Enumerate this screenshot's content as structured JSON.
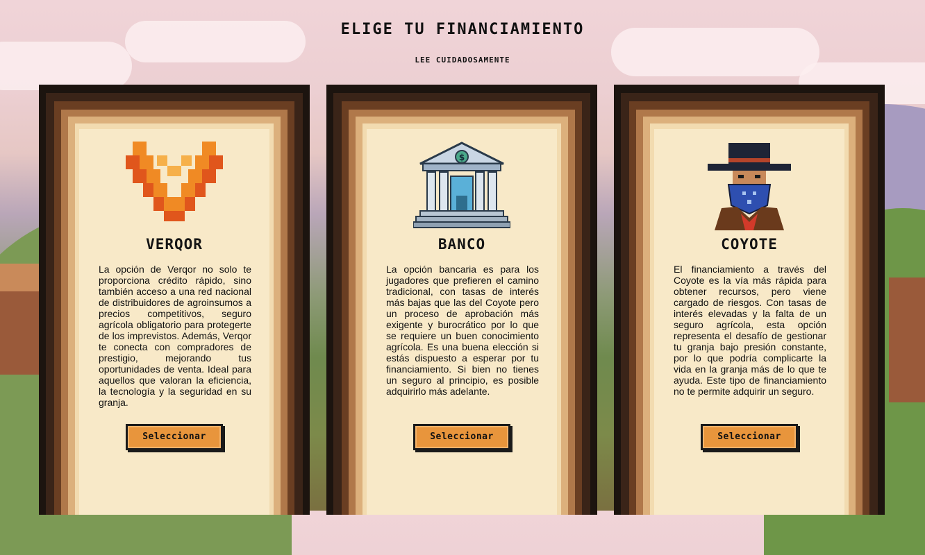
{
  "header": {
    "title": "ELIGE TU FINANCIAMIENTO",
    "subtitle": "LEE CUIDADOSAMENTE"
  },
  "options": [
    {
      "name": "VERQOR",
      "icon": "verqor-logo-icon",
      "description": "La opción de Verqor no solo te proporciona crédito rápido, sino también acceso a una red nacional de distribuidores de agroinsumos a precios competitivos, seguro agrícola obligatorio para protegerte de los imprevistos. Además, Verqor te conecta con compradores de prestigio, mejorando tus oportunidades de venta. Ideal para aquellos que valoran la eficiencia, la tecnología y la seguridad en su granja.",
      "button_label": "Seleccionar"
    },
    {
      "name": "BANCO",
      "icon": "bank-building-icon",
      "description": "La opción bancaria es para los jugadores que prefieren el camino tradicional, con tasas de interés más bajas que las del Coyote pero un proceso de aprobación más exigente y burocrático por lo que se requiere un buen conocimiento agrícola. Es una buena elección si estás dispuesto a esperar por tu financiamiento. Si bien no tienes un seguro al principio, es posible adquirirlo más adelante.",
      "button_label": "Seleccionar"
    },
    {
      "name": "COYOTE",
      "icon": "bandit-coyote-icon",
      "description": "El financiamiento a través del Coyote es la vía más rápida para obtener recursos, pero viene cargado de riesgos. Con tasas de interés elevadas y la falta de un seguro agrícola, esta opción representa el desafío de gestionar tu granja bajo presión constante, por lo que podría complicarte la vida en la granja más de lo que te ayuda. Este tipo de financiamiento no te permite adquirir un seguro.",
      "button_label": "Seleccionar"
    }
  ],
  "colors": {
    "button": "#e8953c",
    "card_inner": "#f8e9c8",
    "frame_dark": "#1c140f"
  }
}
